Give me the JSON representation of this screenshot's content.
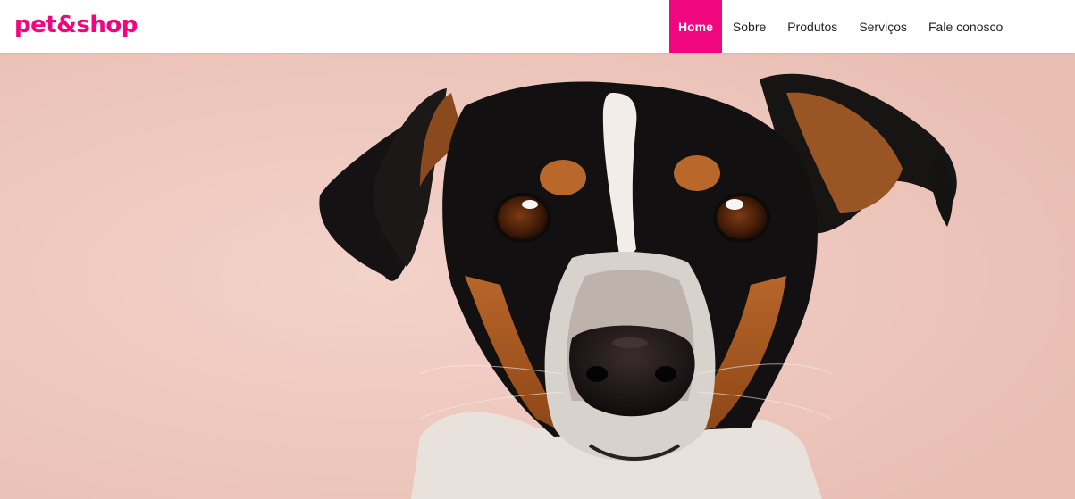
{
  "brand": {
    "logo_text": "pet&shop",
    "accent_color": "#f0067f"
  },
  "nav": {
    "items": [
      {
        "label": "Home",
        "active": true
      },
      {
        "label": "Sobre",
        "active": false
      },
      {
        "label": "Produtos",
        "active": false
      },
      {
        "label": "Serviços",
        "active": false
      },
      {
        "label": "Fale conosco",
        "active": false
      }
    ]
  },
  "hero": {
    "background_color": "#efc7be"
  }
}
